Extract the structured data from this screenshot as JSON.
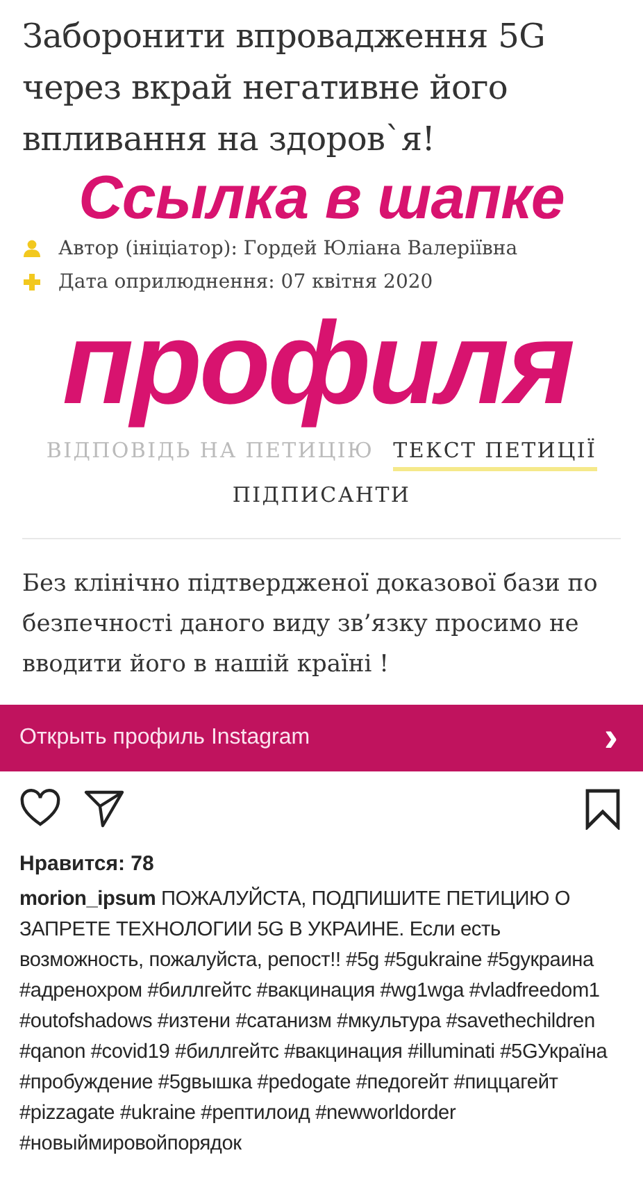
{
  "petition": {
    "title": "Заборонити впровадження 5G через вкрай негативне його впливання на здоров`я!",
    "meta": [
      {
        "kind": "author",
        "text": "Автор (ініціатор): Гордей Юліана Валеріївна"
      },
      {
        "kind": "date",
        "text": "Дата оприлюднення: 07 квітня 2020"
      }
    ],
    "tabs": [
      {
        "label": "ВІДПОВІДЬ НА ПЕТИЦІЮ",
        "selected": false
      },
      {
        "label": "ТЕКСТ ПЕТИЦІЇ",
        "selected": true
      },
      {
        "label": "ПІДПИСАНТИ",
        "selected": false
      }
    ],
    "body": "Без клінічно підтвердженої доказової бази по безпечності даного виду зв’язку просимо не вводити його в нашій країні !"
  },
  "overlay": {
    "line_1": "Ссылка в шапке",
    "line_2": "профиля"
  },
  "profile_bar": {
    "label": "Открыть профиль Instagram",
    "chevron": "›"
  },
  "likes": "Нравится: 78",
  "caption": "**morion_ipsum** ПОЖАЛУЙСТА, ПОДПИШИТЕ ПЕТИЦИЮ О ЗАПРЕТЕ ТЕХНОЛОГИИ 5G В УКРАИНЕ. Если есть возможность, пожалуйста, репост!! #5g #5gukraine #5gукраина #адренохром #биллгейтс #вакцинация #wg1wga #vladfreedom1 #outofshadows #изтени #сатанизм #мкультура #savethechildren #qanon #covid19 #биллгейтс #вакцинация #illuminati #5GУкраїна #пробуждение #5gвышка #pedogate #педогейт #пиццагейт #pizzagate #ukraine #рептилоид #newworldorder #новыймировойпорядок"
}
